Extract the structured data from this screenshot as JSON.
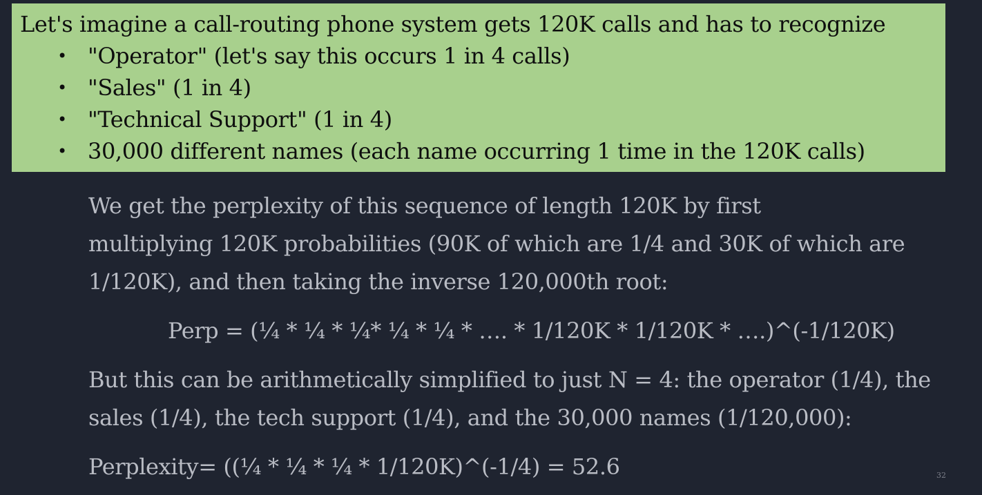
{
  "slide": {
    "intro": {
      "lead": "Let's imagine a call-routing phone system gets 120K calls and has to recognize",
      "bullet_glyph": "•",
      "bullets": [
        "\"Operator\" (let's say this occurs 1 in 4 calls)",
        "\"Sales\" (1 in 4)",
        "\"Technical Support\" (1 in 4)",
        "30,000 different names (each name occurring 1 time in the 120K calls)"
      ]
    },
    "explanation_lines": [
      "We get the perplexity of  this sequence of  length 120K by first",
      "multiplying 120K probabilities (90K of  which are 1/4 and 30K of  which are",
      "1/120K), and then taking  the inverse 120,000th root:"
    ],
    "formula": "Perp = (¼ * ¼ * ¼* ¼ * ¼ * …. * 1/120K * 1/120K * ….)^(-1/120K)",
    "simplification_lines": [
      "But this can be arithmetically simplified to just N = 4:  the operator (1/4), the",
      "sales (1/4), the tech support (1/4), and the 30,000 names (1/120,000):"
    ],
    "result": "Perplexity= ((¼ * ¼ * ¼ * 1/120K)^(-1/4) = 52.6",
    "page_number": "32",
    "colors": {
      "background": "#1f2430",
      "highlight_box": "#a8d08d",
      "box_text": "#0e0e0e",
      "body_text": "#b9bcc4"
    }
  }
}
